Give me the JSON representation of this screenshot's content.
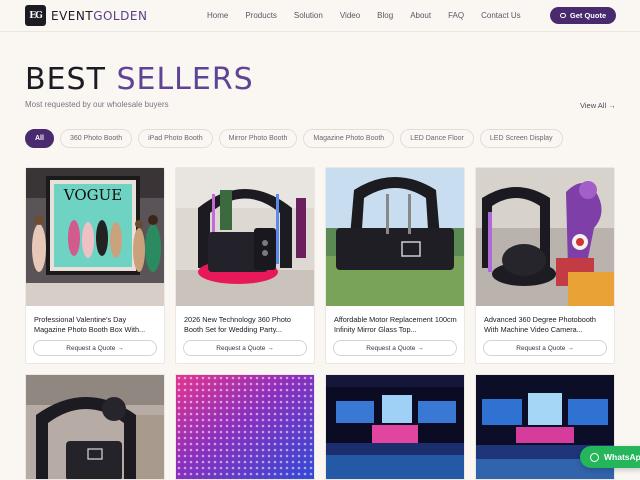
{
  "header": {
    "logo_mark": "EG",
    "logo_text_1": "EVENT",
    "logo_text_2": "GOLDEN",
    "nav": [
      "Home",
      "Products",
      "Solution",
      "Video",
      "Blog",
      "About",
      "FAQ",
      "Contact Us"
    ],
    "quote_label": "Get Quote"
  },
  "hero": {
    "title_1": "BEST ",
    "title_2": "SELLERS",
    "subtitle": "Most requested by our wholesale buyers",
    "view_all": "View All →"
  },
  "filters": [
    "All",
    "360 Photo Booth",
    "iPad Photo Booth",
    "Mirror Photo Booth",
    "Magazine Photo Booth",
    "LED Dance Floor",
    "LED Screen Display"
  ],
  "products": [
    {
      "name": "Professional Valentine's Day Magazine Photo Booth Box With...",
      "cta": "Request a Quote →"
    },
    {
      "name": "2026 New Technology 360 Photo Booth Set for Wedding Party...",
      "cta": "Request a Quote →"
    },
    {
      "name": "Affordable Motor Replacement 100cm Infinity Mirror Glass Top...",
      "cta": "Request a Quote →"
    },
    {
      "name": "Advanced 360 Degree Photobooth With Machine Video Camera...",
      "cta": "Request a Quote →"
    }
  ],
  "magazine_text": "VOGUE",
  "whatsapp_label": "WhatsApp",
  "colors": {
    "brand": "#4a2a6e",
    "accent": "#5f4394",
    "whatsapp": "#25b55a",
    "background": "#faf7f3"
  }
}
